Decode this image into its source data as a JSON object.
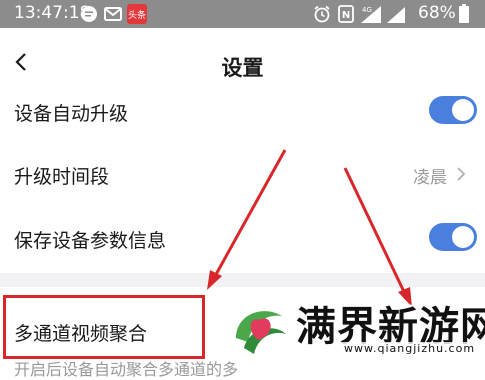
{
  "status_bar": {
    "time": "13:47:18",
    "battery": "68%",
    "icons": [
      "chat-bubble-icon",
      "mail-icon",
      "news-app-icon",
      "alarm-icon",
      "nfc-icon",
      "signal-icon",
      "battery-icon"
    ],
    "news_app_badge": "头条",
    "network_label": "4G"
  },
  "header": {
    "title": "设置",
    "back_icon": "chevron-left-icon"
  },
  "settings": [
    {
      "label": "设备自动升级",
      "control": "toggle",
      "on": true
    },
    {
      "label": "升级时间段",
      "value": "凌晨",
      "control": "chevron"
    },
    {
      "label": "保存设备参数信息",
      "control": "toggle",
      "on": true
    },
    {
      "label": "多通道视频聚合",
      "control": "toggle",
      "highlighted": true
    }
  ],
  "cut_off_text": "开启后设备自动聚合多通道的多",
  "annotation": {
    "arrow_color": "#d8262a",
    "box_color": "#d8262a"
  },
  "watermark": {
    "title": "满界新游网",
    "url": "www.qiangjizhu.com"
  },
  "colors": {
    "toggle_on": "#4a7fe0",
    "status_bar": "#8c8c8c",
    "annotation": "#d8262a"
  }
}
